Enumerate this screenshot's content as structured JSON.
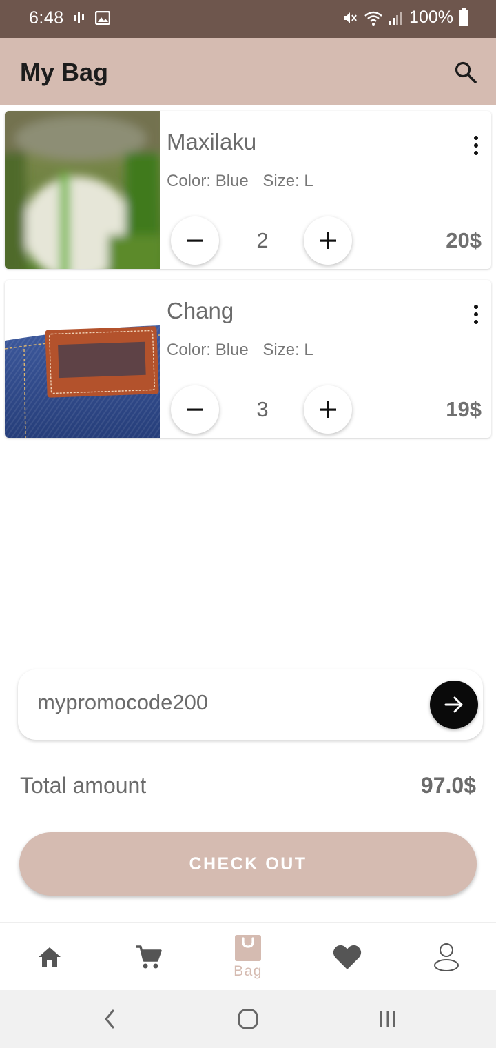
{
  "status": {
    "time": "6:48",
    "battery": "100%"
  },
  "header": {
    "title": "My Bag"
  },
  "cart": {
    "items": [
      {
        "name": "Maxilaku",
        "color_label": "Color: Blue",
        "size_label": "Size: L",
        "quantity": "2",
        "price": "20$",
        "image": "bag-photo"
      },
      {
        "name": "Chang",
        "color_label": "Color: Blue",
        "size_label": "Size: L",
        "quantity": "3",
        "price": "19$",
        "image": "jeans-label-photo"
      }
    ]
  },
  "promo": {
    "value": "mypromocode200"
  },
  "total": {
    "label": "Total amount",
    "value": "97.0$"
  },
  "checkout": {
    "label": "CHECK OUT"
  },
  "bottom_nav": {
    "items": [
      {
        "icon": "home-icon"
      },
      {
        "icon": "cart-icon"
      },
      {
        "icon": "bag-icon",
        "label": "Bag",
        "active": true
      },
      {
        "icon": "heart-icon"
      },
      {
        "icon": "profile-icon"
      }
    ]
  },
  "colors": {
    "accent": "#d5bbb1",
    "status_bar": "#6e564d",
    "text_muted": "#6b6b6b"
  }
}
